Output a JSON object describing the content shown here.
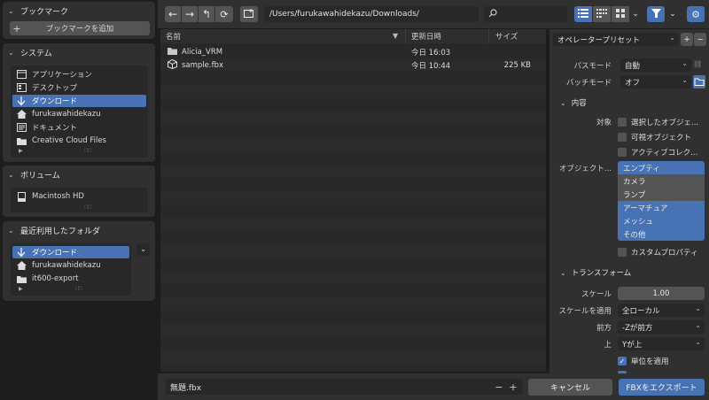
{
  "sidebar": {
    "bookmarks": {
      "title": "ブックマーク",
      "add_label": "ブックマークを追加"
    },
    "system": {
      "title": "システム",
      "items": [
        {
          "label": "アプリケーション",
          "icon": "application-icon"
        },
        {
          "label": "デスクトップ",
          "icon": "desktop-icon"
        },
        {
          "label": "ダウンロード",
          "icon": "download-icon",
          "selected": true
        },
        {
          "label": "furukawahidekazu",
          "icon": "home-icon"
        },
        {
          "label": "ドキュメント",
          "icon": "document-icon"
        },
        {
          "label": "Creative Cloud Files",
          "icon": "folder-icon"
        }
      ]
    },
    "volumes": {
      "title": "ボリューム",
      "items": [
        {
          "label": "Macintosh HD",
          "icon": "disk-icon"
        }
      ]
    },
    "recent": {
      "title": "最近利用したフォルダ",
      "items": [
        {
          "label": "ダウンロード",
          "icon": "download-icon",
          "selected": true
        },
        {
          "label": "furukawahidekazu",
          "icon": "home-icon"
        },
        {
          "label": "it600-export",
          "icon": "folder-icon"
        }
      ]
    }
  },
  "toolbar": {
    "path": "/Users/furukawahidekazu/Downloads/",
    "search_placeholder": ""
  },
  "file_list": {
    "columns": {
      "name": "名前",
      "modified": "更新日時",
      "size": "サイズ"
    },
    "rows": [
      {
        "name": "Alicia_VRM",
        "modified": "今日 16:03",
        "size": "",
        "icon": "folder-icon"
      },
      {
        "name": "sample.fbx",
        "modified": "今日 10:44",
        "size": "225 KB",
        "icon": "cube-icon"
      }
    ]
  },
  "options": {
    "preset_label": "オペレータープリセット",
    "path_mode": {
      "label": "パスモード",
      "value": "自動"
    },
    "batch_mode": {
      "label": "バッチモード",
      "value": "オフ"
    },
    "include": {
      "title": "内容",
      "limit_label": "対象",
      "limit_items": [
        "選択したオブジェ...",
        "可視オブジェクト",
        "アクティブコレク..."
      ],
      "object_types_label": "オブジェクト...",
      "object_types": [
        {
          "label": "エンプティ",
          "on": true
        },
        {
          "label": "カメラ",
          "on": false
        },
        {
          "label": "ランプ",
          "on": false
        },
        {
          "label": "アーマチュア",
          "on": true
        },
        {
          "label": "メッシュ",
          "on": true
        },
        {
          "label": "その他",
          "on": true
        }
      ],
      "custom_props": "カスタムプロパティ"
    },
    "transform": {
      "title": "トランスフォーム",
      "scale_label": "スケール",
      "scale_value": "1.00",
      "apply_scale_label": "スケールを適用",
      "apply_scale_value": "全ローカル",
      "forward_label": "前方",
      "forward_value": "-Zが前方",
      "up_label": "上",
      "up_value": "Yが上",
      "apply_unit": "単位を適用"
    }
  },
  "bottom": {
    "filename": "無題.fbx",
    "cancel_label": "キャンセル",
    "export_label": "FBXをエクスポート"
  },
  "colors": {
    "accent": "#4772b3",
    "panel": "#303030",
    "field": "#282828"
  }
}
